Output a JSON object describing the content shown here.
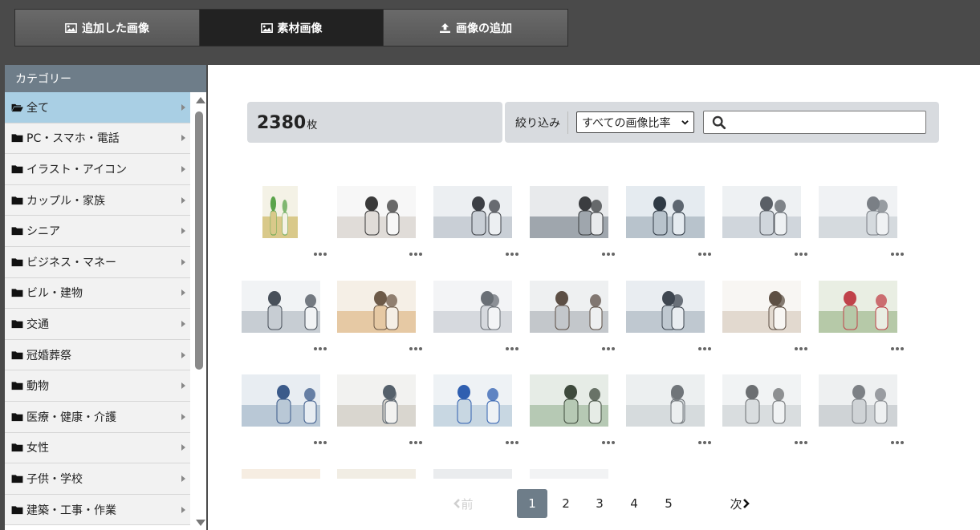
{
  "tabs": [
    {
      "label": "追加した画像",
      "icon": "image-icon"
    },
    {
      "label": "素材画像",
      "icon": "image-icon"
    },
    {
      "label": "画像の追加",
      "icon": "upload-icon"
    }
  ],
  "sidebar": {
    "title": "カテゴリー",
    "items": [
      {
        "label": "全て",
        "icon": "folder-open-icon"
      },
      {
        "label": "PC・スマホ・電話",
        "icon": "folder-icon"
      },
      {
        "label": "イラスト・アイコン",
        "icon": "folder-icon"
      },
      {
        "label": "カップル・家族",
        "icon": "folder-icon"
      },
      {
        "label": "シニア",
        "icon": "folder-icon"
      },
      {
        "label": "ビジネス・マネー",
        "icon": "folder-icon"
      },
      {
        "label": "ビル・建物",
        "icon": "folder-icon"
      },
      {
        "label": "交通",
        "icon": "folder-icon"
      },
      {
        "label": "冠婚葬祭",
        "icon": "folder-icon"
      },
      {
        "label": "動物",
        "icon": "folder-icon"
      },
      {
        "label": "医療・健康・介護",
        "icon": "folder-icon"
      },
      {
        "label": "女性",
        "icon": "folder-icon"
      },
      {
        "label": "子供・学校",
        "icon": "folder-icon"
      },
      {
        "label": "建築・工事・作業",
        "icon": "folder-icon"
      }
    ]
  },
  "main": {
    "count": "2380",
    "count_unit": "枚",
    "filter_label": "絞り込み",
    "ratio_select": "すべての画像比率",
    "search_value": ""
  },
  "images": [
    {
      "colors": [
        "#f4f2e6",
        "#d9c98a",
        "#5aa34a"
      ]
    },
    {
      "colors": [
        "#f7f7f7",
        "#e0dcd8",
        "#3a3a3a"
      ]
    },
    {
      "colors": [
        "#eceff2",
        "#c9cfd6",
        "#3c3f45"
      ]
    },
    {
      "colors": [
        "#e8eaec",
        "#9fa6ad",
        "#3b3d40"
      ]
    },
    {
      "colors": [
        "#e5ebf0",
        "#b8c3cc",
        "#2f3a45"
      ]
    },
    {
      "colors": [
        "#eef1f3",
        "#d0d6dc",
        "#5a5f66"
      ]
    },
    {
      "colors": [
        "#f0f2f4",
        "#d5dade",
        "#7a7f85"
      ]
    },
    {
      "colors": [
        "#f1f3f5",
        "#c7cdd3",
        "#48505a"
      ]
    },
    {
      "colors": [
        "#f5efe6",
        "#e6c9a4",
        "#6d5a48"
      ]
    },
    {
      "colors": [
        "#f3f4f6",
        "#d6d9de",
        "#6a6f76"
      ]
    },
    {
      "colors": [
        "#eef0f1",
        "#c3c7cb",
        "#5c4f45"
      ]
    },
    {
      "colors": [
        "#e9edf1",
        "#bfc8d0",
        "#3e4650"
      ]
    },
    {
      "colors": [
        "#f8f6f3",
        "#e2d9cf",
        "#5e5044"
      ]
    },
    {
      "colors": [
        "#e9eee3",
        "#b6c9a8",
        "#c0424a"
      ]
    },
    {
      "colors": [
        "#e8edf2",
        "#b9c8d6",
        "#3b5a8a"
      ]
    },
    {
      "colors": [
        "#f2f2f0",
        "#d9d6cf",
        "#55606b"
      ]
    },
    {
      "colors": [
        "#eef2f5",
        "#c8d7e2",
        "#2f5fb0"
      ]
    },
    {
      "colors": [
        "#e6ece6",
        "#b6c9b4",
        "#3e4a3c"
      ]
    },
    {
      "colors": [
        "#eceff0",
        "#d6dbdd",
        "#70757a"
      ]
    },
    {
      "colors": [
        "#f1f3f4",
        "#d9dddf",
        "#6c6f72"
      ]
    },
    {
      "colors": [
        "#eef0f1",
        "#cfd3d6",
        "#7c8085"
      ]
    },
    {
      "colors": [
        "#f6ede2",
        "#e9c28b",
        "#7a4e2a"
      ]
    },
    {
      "colors": [
        "#f1ede4",
        "#d8cba8",
        "#4a3f33"
      ]
    },
    {
      "colors": [
        "#eaecee",
        "#c5cacf",
        "#3f454b"
      ]
    },
    {
      "colors": [
        "#f2f3f4",
        "#cdd1d5",
        "#2b2f33"
      ]
    }
  ],
  "pagination": {
    "prev": "前",
    "pages": [
      "1",
      "2",
      "3",
      "4",
      "5"
    ],
    "next": "次",
    "current": "1"
  },
  "colors": {
    "active_category": "#a9cfe4",
    "header_gray": "#6e7d89",
    "active_tab": "#222222"
  }
}
